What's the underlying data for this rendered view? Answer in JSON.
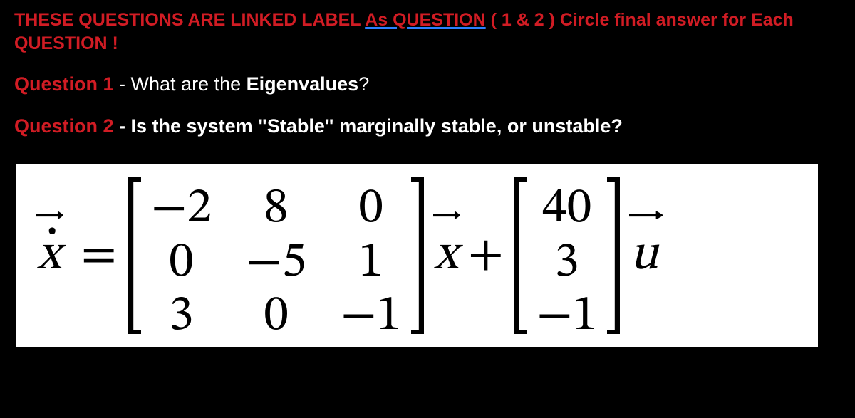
{
  "header": {
    "part1": "THESE QUESTIONS ARE LINKED LABEL ",
    "underlined": "As  QUESTION",
    "part2": " (   1 & 2     ) Circle final answer for Each QUESTION !"
  },
  "q1": {
    "label": "Question 1 ",
    "dash": "- ",
    "pre": "What are the ",
    "bold": "Eigenvalues",
    "post": "?"
  },
  "q2": {
    "label": "Question 2 ",
    "rest": "- Is the system \"Stable\" marginally stable, or unstable?"
  },
  "eq": {
    "xdot": "x",
    "equals": "=",
    "A": [
      "−2",
      "8",
      "0",
      "0",
      "−5",
      "1",
      "3",
      "0",
      "−1"
    ],
    "xvec": "x",
    "plus": "+",
    "B": [
      "40",
      "3",
      "−1"
    ],
    "uvec": "u"
  }
}
